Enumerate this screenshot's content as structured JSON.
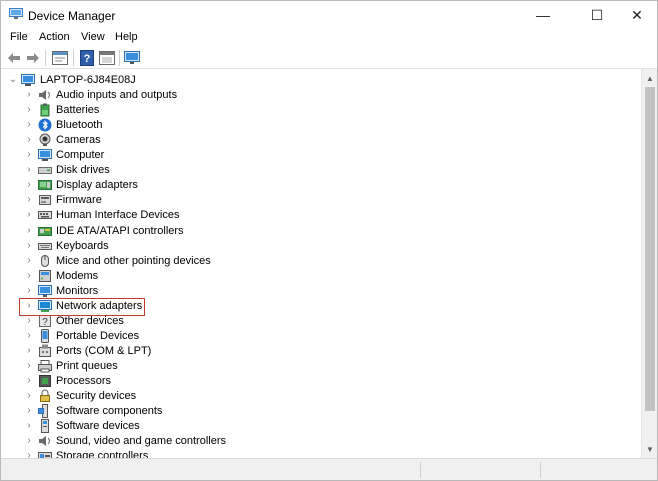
{
  "window": {
    "title": "Device Manager",
    "icon": "device-manager-icon",
    "controls": {
      "minimize": "—",
      "maximize": "☐",
      "close": "✕"
    }
  },
  "menu": [
    "File",
    "Action",
    "View",
    "Help"
  ],
  "toolbar": {
    "buttons": [
      "back-arrow-icon",
      "forward-arrow-icon",
      "properties-icon",
      "help-icon",
      "console-icon",
      "monitor-icon"
    ]
  },
  "tree": {
    "root": {
      "label": "LAPTOP-6J84E08J",
      "expanded": true,
      "icon": "computer-icon"
    },
    "items": [
      {
        "label": "Audio inputs and outputs",
        "icon": "speaker-icon"
      },
      {
        "label": "Batteries",
        "icon": "battery-icon"
      },
      {
        "label": "Bluetooth",
        "icon": "bluetooth-icon"
      },
      {
        "label": "Cameras",
        "icon": "camera-icon"
      },
      {
        "label": "Computer",
        "icon": "computer-icon"
      },
      {
        "label": "Disk drives",
        "icon": "disk-drive-icon"
      },
      {
        "label": "Display adapters",
        "icon": "display-adapter-icon"
      },
      {
        "label": "Firmware",
        "icon": "firmware-icon"
      },
      {
        "label": "Human Interface Devices",
        "icon": "hid-icon"
      },
      {
        "label": "IDE ATA/ATAPI controllers",
        "icon": "ide-controller-icon"
      },
      {
        "label": "Keyboards",
        "icon": "keyboard-icon"
      },
      {
        "label": "Mice and other pointing devices",
        "icon": "mouse-icon"
      },
      {
        "label": "Modems",
        "icon": "modem-icon"
      },
      {
        "label": "Monitors",
        "icon": "monitor-icon"
      },
      {
        "label": "Network adapters",
        "icon": "network-adapter-icon",
        "highlighted": true
      },
      {
        "label": "Other devices",
        "icon": "unknown-device-icon"
      },
      {
        "label": "Portable Devices",
        "icon": "portable-device-icon"
      },
      {
        "label": "Ports (COM & LPT)",
        "icon": "port-icon"
      },
      {
        "label": "Print queues",
        "icon": "printer-icon"
      },
      {
        "label": "Processors",
        "icon": "processor-icon"
      },
      {
        "label": "Security devices",
        "icon": "security-device-icon"
      },
      {
        "label": "Software components",
        "icon": "software-component-icon"
      },
      {
        "label": "Software devices",
        "icon": "software-device-icon"
      },
      {
        "label": "Sound, video and game controllers",
        "icon": "sound-controller-icon"
      },
      {
        "label": "Storage controllers",
        "icon": "storage-controller-icon"
      }
    ]
  },
  "colors": {
    "highlight_border": "#c0392b",
    "accent_blue": "#1e88d4",
    "scrollbar_thumb": "#c2c2c2"
  }
}
